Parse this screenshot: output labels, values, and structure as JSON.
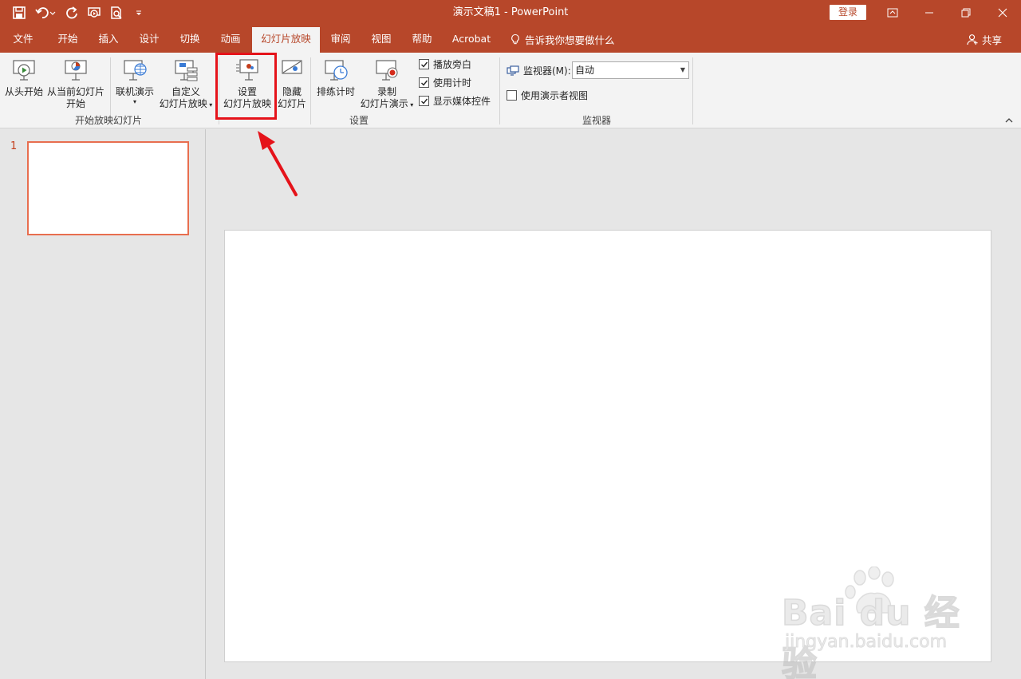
{
  "app": {
    "title": "演示文稿1  -  PowerPoint",
    "login_label": "登录"
  },
  "tabs": [
    {
      "label": "文件"
    },
    {
      "label": "开始"
    },
    {
      "label": "插入"
    },
    {
      "label": "设计"
    },
    {
      "label": "切换"
    },
    {
      "label": "动画"
    },
    {
      "label": "幻灯片放映"
    },
    {
      "label": "审阅"
    },
    {
      "label": "视图"
    },
    {
      "label": "帮助"
    },
    {
      "label": "Acrobat"
    }
  ],
  "tell_me": "告诉我你想要做什么",
  "share": "共享",
  "ribbon": {
    "start_group": {
      "label": "开始放映幻灯片",
      "from_beginning": "从头开始",
      "from_current_1": "从当前幻灯片",
      "from_current_2": "开始",
      "online": "联机演示",
      "custom_1": "自定义",
      "custom_2": "幻灯片放映"
    },
    "setup_group": {
      "label": "设置",
      "setup_1": "设置",
      "setup_2": "幻灯片放映",
      "hide_1": "隐藏",
      "hide_2": "幻灯片",
      "rehearse": "排练计时",
      "record_1": "录制",
      "record_2": "幻灯片演示",
      "play_narrations": "播放旁白",
      "use_timings": "使用计时",
      "show_media_controls": "显示媒体控件"
    },
    "monitors_group": {
      "label": "监视器",
      "monitor_label": "监视器(M):",
      "monitor_value": "自动",
      "presenter_view": "使用演示者视图"
    }
  },
  "slides": {
    "thumb_number": "1"
  },
  "watermark": {
    "main": "Bai du 经验",
    "sub": "jingyan.baidu.com"
  },
  "colors": {
    "accent": "#b7472a",
    "highlight_box": "#e5131a",
    "slide_selected": "#e86e4f"
  }
}
